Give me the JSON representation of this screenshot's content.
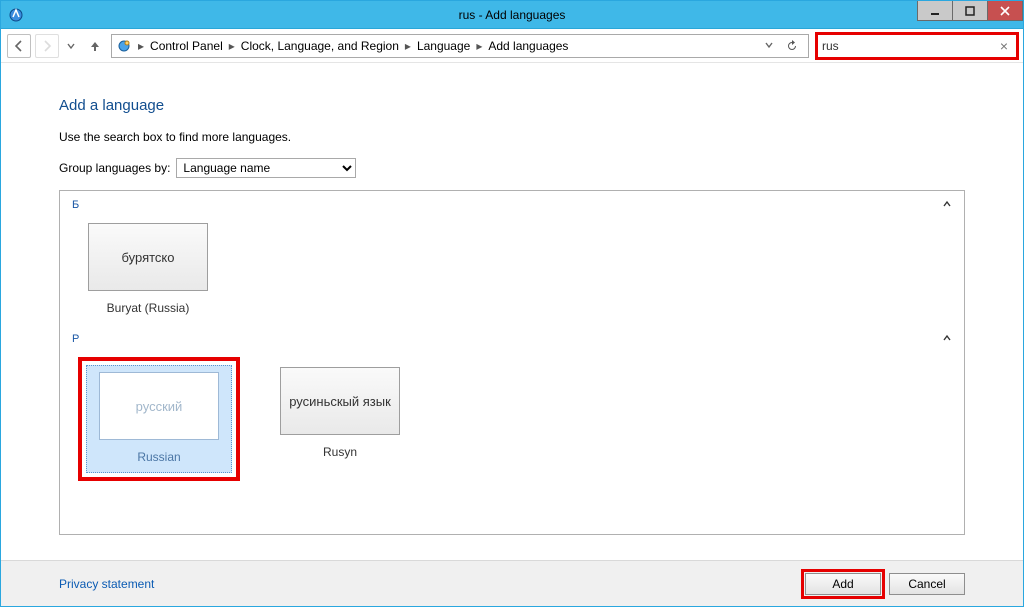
{
  "window": {
    "title": "rus - Add languages"
  },
  "nav": {
    "breadcrumbs": [
      "Control Panel",
      "Clock, Language, and Region",
      "Language",
      "Add languages"
    ]
  },
  "search": {
    "value": "rus"
  },
  "page": {
    "title": "Add a language",
    "hint": "Use the search box to find more languages.",
    "group_label": "Group languages by:",
    "group_options": [
      "Language name"
    ],
    "group_selected": "Language name"
  },
  "groups": [
    {
      "letter": "Б",
      "items": [
        {
          "native": "бурятско",
          "label": "Buryat (Russia)",
          "selected": false
        }
      ]
    },
    {
      "letter": "Р",
      "items": [
        {
          "native": "русский",
          "label": "Russian",
          "selected": true
        },
        {
          "native": "русиньскый язык",
          "label": "Rusyn",
          "selected": false
        }
      ]
    }
  ],
  "footer": {
    "privacy": "Privacy statement",
    "add": "Add",
    "cancel": "Cancel"
  }
}
